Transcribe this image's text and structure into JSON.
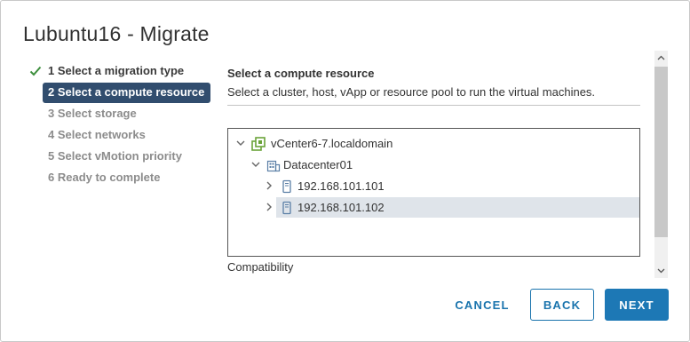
{
  "dialog": {
    "title": "Lubuntu16 - Migrate"
  },
  "steps": [
    {
      "label": "1 Select a migration type",
      "state": "done"
    },
    {
      "label": "2 Select a compute resource",
      "state": "active"
    },
    {
      "label": "3 Select storage",
      "state": "pending"
    },
    {
      "label": "4 Select networks",
      "state": "pending"
    },
    {
      "label": "5 Select vMotion priority",
      "state": "pending"
    },
    {
      "label": "6 Ready to complete",
      "state": "pending"
    }
  ],
  "main": {
    "heading": "Select a compute resource",
    "subheading": "Select a cluster, host, vApp or resource pool to run the virtual machines.",
    "compatibility_label": "Compatibility"
  },
  "tree": {
    "nodes": [
      {
        "label": "vCenter6-7.localdomain",
        "icon": "vcenter-icon",
        "expanded": true
      },
      {
        "label": "Datacenter01",
        "icon": "datacenter-icon",
        "expanded": true
      },
      {
        "label": "192.168.101.101",
        "icon": "host-icon",
        "expanded": false
      },
      {
        "label": "192.168.101.102",
        "icon": "host-icon",
        "expanded": false,
        "selected": true
      }
    ]
  },
  "buttons": {
    "cancel": "CANCEL",
    "back": "BACK",
    "next": "NEXT"
  },
  "colors": {
    "accent": "#1d78b5",
    "active_step": "#314d6e",
    "done_check": "#3d8f3d",
    "selected_row": "#dfe4ea"
  }
}
